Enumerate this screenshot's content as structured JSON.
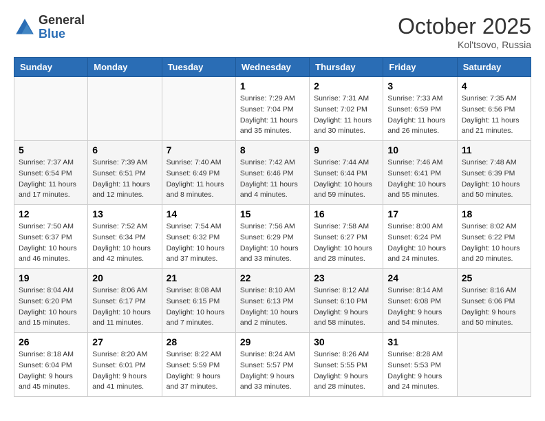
{
  "header": {
    "logo_general": "General",
    "logo_blue": "Blue",
    "month": "October 2025",
    "location": "Kol'tsovo, Russia"
  },
  "weekdays": [
    "Sunday",
    "Monday",
    "Tuesday",
    "Wednesday",
    "Thursday",
    "Friday",
    "Saturday"
  ],
  "weeks": [
    [
      {
        "day": "",
        "info": []
      },
      {
        "day": "",
        "info": []
      },
      {
        "day": "",
        "info": []
      },
      {
        "day": "1",
        "info": [
          "Sunrise: 7:29 AM",
          "Sunset: 7:04 PM",
          "Daylight: 11 hours and 35 minutes."
        ]
      },
      {
        "day": "2",
        "info": [
          "Sunrise: 7:31 AM",
          "Sunset: 7:02 PM",
          "Daylight: 11 hours and 30 minutes."
        ]
      },
      {
        "day": "3",
        "info": [
          "Sunrise: 7:33 AM",
          "Sunset: 6:59 PM",
          "Daylight: 11 hours and 26 minutes."
        ]
      },
      {
        "day": "4",
        "info": [
          "Sunrise: 7:35 AM",
          "Sunset: 6:56 PM",
          "Daylight: 11 hours and 21 minutes."
        ]
      }
    ],
    [
      {
        "day": "5",
        "info": [
          "Sunrise: 7:37 AM",
          "Sunset: 6:54 PM",
          "Daylight: 11 hours and 17 minutes."
        ]
      },
      {
        "day": "6",
        "info": [
          "Sunrise: 7:39 AM",
          "Sunset: 6:51 PM",
          "Daylight: 11 hours and 12 minutes."
        ]
      },
      {
        "day": "7",
        "info": [
          "Sunrise: 7:40 AM",
          "Sunset: 6:49 PM",
          "Daylight: 11 hours and 8 minutes."
        ]
      },
      {
        "day": "8",
        "info": [
          "Sunrise: 7:42 AM",
          "Sunset: 6:46 PM",
          "Daylight: 11 hours and 4 minutes."
        ]
      },
      {
        "day": "9",
        "info": [
          "Sunrise: 7:44 AM",
          "Sunset: 6:44 PM",
          "Daylight: 10 hours and 59 minutes."
        ]
      },
      {
        "day": "10",
        "info": [
          "Sunrise: 7:46 AM",
          "Sunset: 6:41 PM",
          "Daylight: 10 hours and 55 minutes."
        ]
      },
      {
        "day": "11",
        "info": [
          "Sunrise: 7:48 AM",
          "Sunset: 6:39 PM",
          "Daylight: 10 hours and 50 minutes."
        ]
      }
    ],
    [
      {
        "day": "12",
        "info": [
          "Sunrise: 7:50 AM",
          "Sunset: 6:37 PM",
          "Daylight: 10 hours and 46 minutes."
        ]
      },
      {
        "day": "13",
        "info": [
          "Sunrise: 7:52 AM",
          "Sunset: 6:34 PM",
          "Daylight: 10 hours and 42 minutes."
        ]
      },
      {
        "day": "14",
        "info": [
          "Sunrise: 7:54 AM",
          "Sunset: 6:32 PM",
          "Daylight: 10 hours and 37 minutes."
        ]
      },
      {
        "day": "15",
        "info": [
          "Sunrise: 7:56 AM",
          "Sunset: 6:29 PM",
          "Daylight: 10 hours and 33 minutes."
        ]
      },
      {
        "day": "16",
        "info": [
          "Sunrise: 7:58 AM",
          "Sunset: 6:27 PM",
          "Daylight: 10 hours and 28 minutes."
        ]
      },
      {
        "day": "17",
        "info": [
          "Sunrise: 8:00 AM",
          "Sunset: 6:24 PM",
          "Daylight: 10 hours and 24 minutes."
        ]
      },
      {
        "day": "18",
        "info": [
          "Sunrise: 8:02 AM",
          "Sunset: 6:22 PM",
          "Daylight: 10 hours and 20 minutes."
        ]
      }
    ],
    [
      {
        "day": "19",
        "info": [
          "Sunrise: 8:04 AM",
          "Sunset: 6:20 PM",
          "Daylight: 10 hours and 15 minutes."
        ]
      },
      {
        "day": "20",
        "info": [
          "Sunrise: 8:06 AM",
          "Sunset: 6:17 PM",
          "Daylight: 10 hours and 11 minutes."
        ]
      },
      {
        "day": "21",
        "info": [
          "Sunrise: 8:08 AM",
          "Sunset: 6:15 PM",
          "Daylight: 10 hours and 7 minutes."
        ]
      },
      {
        "day": "22",
        "info": [
          "Sunrise: 8:10 AM",
          "Sunset: 6:13 PM",
          "Daylight: 10 hours and 2 minutes."
        ]
      },
      {
        "day": "23",
        "info": [
          "Sunrise: 8:12 AM",
          "Sunset: 6:10 PM",
          "Daylight: 9 hours and 58 minutes."
        ]
      },
      {
        "day": "24",
        "info": [
          "Sunrise: 8:14 AM",
          "Sunset: 6:08 PM",
          "Daylight: 9 hours and 54 minutes."
        ]
      },
      {
        "day": "25",
        "info": [
          "Sunrise: 8:16 AM",
          "Sunset: 6:06 PM",
          "Daylight: 9 hours and 50 minutes."
        ]
      }
    ],
    [
      {
        "day": "26",
        "info": [
          "Sunrise: 8:18 AM",
          "Sunset: 6:04 PM",
          "Daylight: 9 hours and 45 minutes."
        ]
      },
      {
        "day": "27",
        "info": [
          "Sunrise: 8:20 AM",
          "Sunset: 6:01 PM",
          "Daylight: 9 hours and 41 minutes."
        ]
      },
      {
        "day": "28",
        "info": [
          "Sunrise: 8:22 AM",
          "Sunset: 5:59 PM",
          "Daylight: 9 hours and 37 minutes."
        ]
      },
      {
        "day": "29",
        "info": [
          "Sunrise: 8:24 AM",
          "Sunset: 5:57 PM",
          "Daylight: 9 hours and 33 minutes."
        ]
      },
      {
        "day": "30",
        "info": [
          "Sunrise: 8:26 AM",
          "Sunset: 5:55 PM",
          "Daylight: 9 hours and 28 minutes."
        ]
      },
      {
        "day": "31",
        "info": [
          "Sunrise: 8:28 AM",
          "Sunset: 5:53 PM",
          "Daylight: 9 hours and 24 minutes."
        ]
      },
      {
        "day": "",
        "info": []
      }
    ]
  ]
}
